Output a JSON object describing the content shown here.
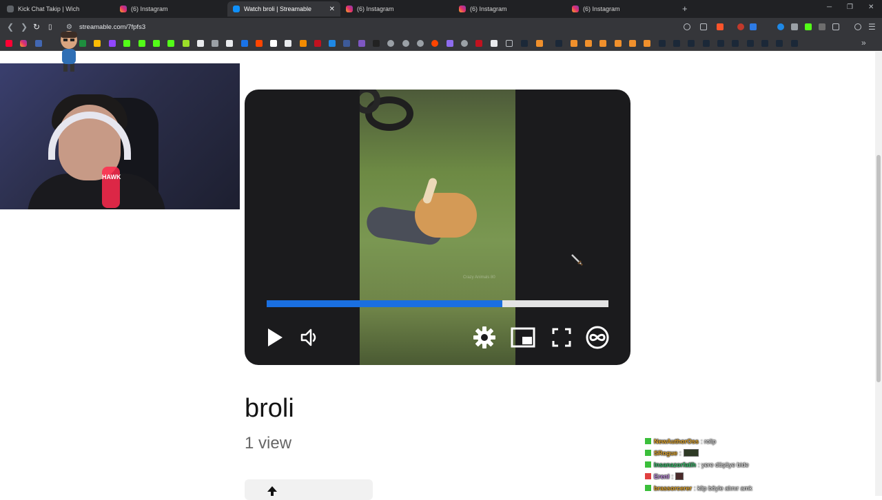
{
  "browser": {
    "tabs": [
      {
        "label": "Kick Chat Takip | Wich",
        "icon": "kick-favicon-icon",
        "active": false
      },
      {
        "label": "(6) Instagram",
        "icon": "instagram-icon",
        "active": false
      },
      {
        "label": "Watch broli | Streamable",
        "icon": "streamable-icon",
        "active": true
      },
      {
        "label": "(6) Instagram",
        "icon": "instagram-icon",
        "active": false
      },
      {
        "label": "(6) Instagram",
        "icon": "instagram-icon",
        "active": false
      },
      {
        "label": "(6) Instagram",
        "icon": "instagram-icon",
        "active": false
      }
    ],
    "new_tab": "+",
    "window_controls": {
      "minimize": "─",
      "restore": "❐",
      "close": "✕"
    },
    "url": "streamable.com/7fpfs3",
    "nav": {
      "back": "❮",
      "forward": "❯",
      "reload": "↻"
    }
  },
  "webcam": {
    "chair_brand": "HAWK"
  },
  "player": {
    "progress": 0.69,
    "video_watermark": "Crazy Animals 80"
  },
  "video": {
    "title": "broli",
    "views": "1 view"
  },
  "chat": [
    {
      "user": "NewAuthorOss",
      "message": ": rolip",
      "user_color": "#e6a92e",
      "badge_color": "#3bbf3b",
      "emote": false
    },
    {
      "user": "SRogue",
      "message": " :",
      "user_color": "#e6a92e",
      "badge_color": "#3bbf3b",
      "emote": true
    },
    {
      "user": "Insanazorfatih",
      "message": ": yere düşüye bide",
      "user_color": "#3cc06f",
      "badge_color": "#3bbf3b",
      "emote": false
    },
    {
      "user": "Erenl",
      "message": " :",
      "user_color": "#c18fe0",
      "badge_color": "#e04040",
      "emote": true
    },
    {
      "user": "brassorcerer",
      "message": ": klip böyle alınır amk",
      "user_color": "#e6a92e",
      "badge_color": "#3bbf3b",
      "emote": false
    }
  ],
  "colors": {
    "accent_progress": "#1a6fe0",
    "player_bg": "#1b1b1d",
    "browser_chrome": "#35363a"
  }
}
